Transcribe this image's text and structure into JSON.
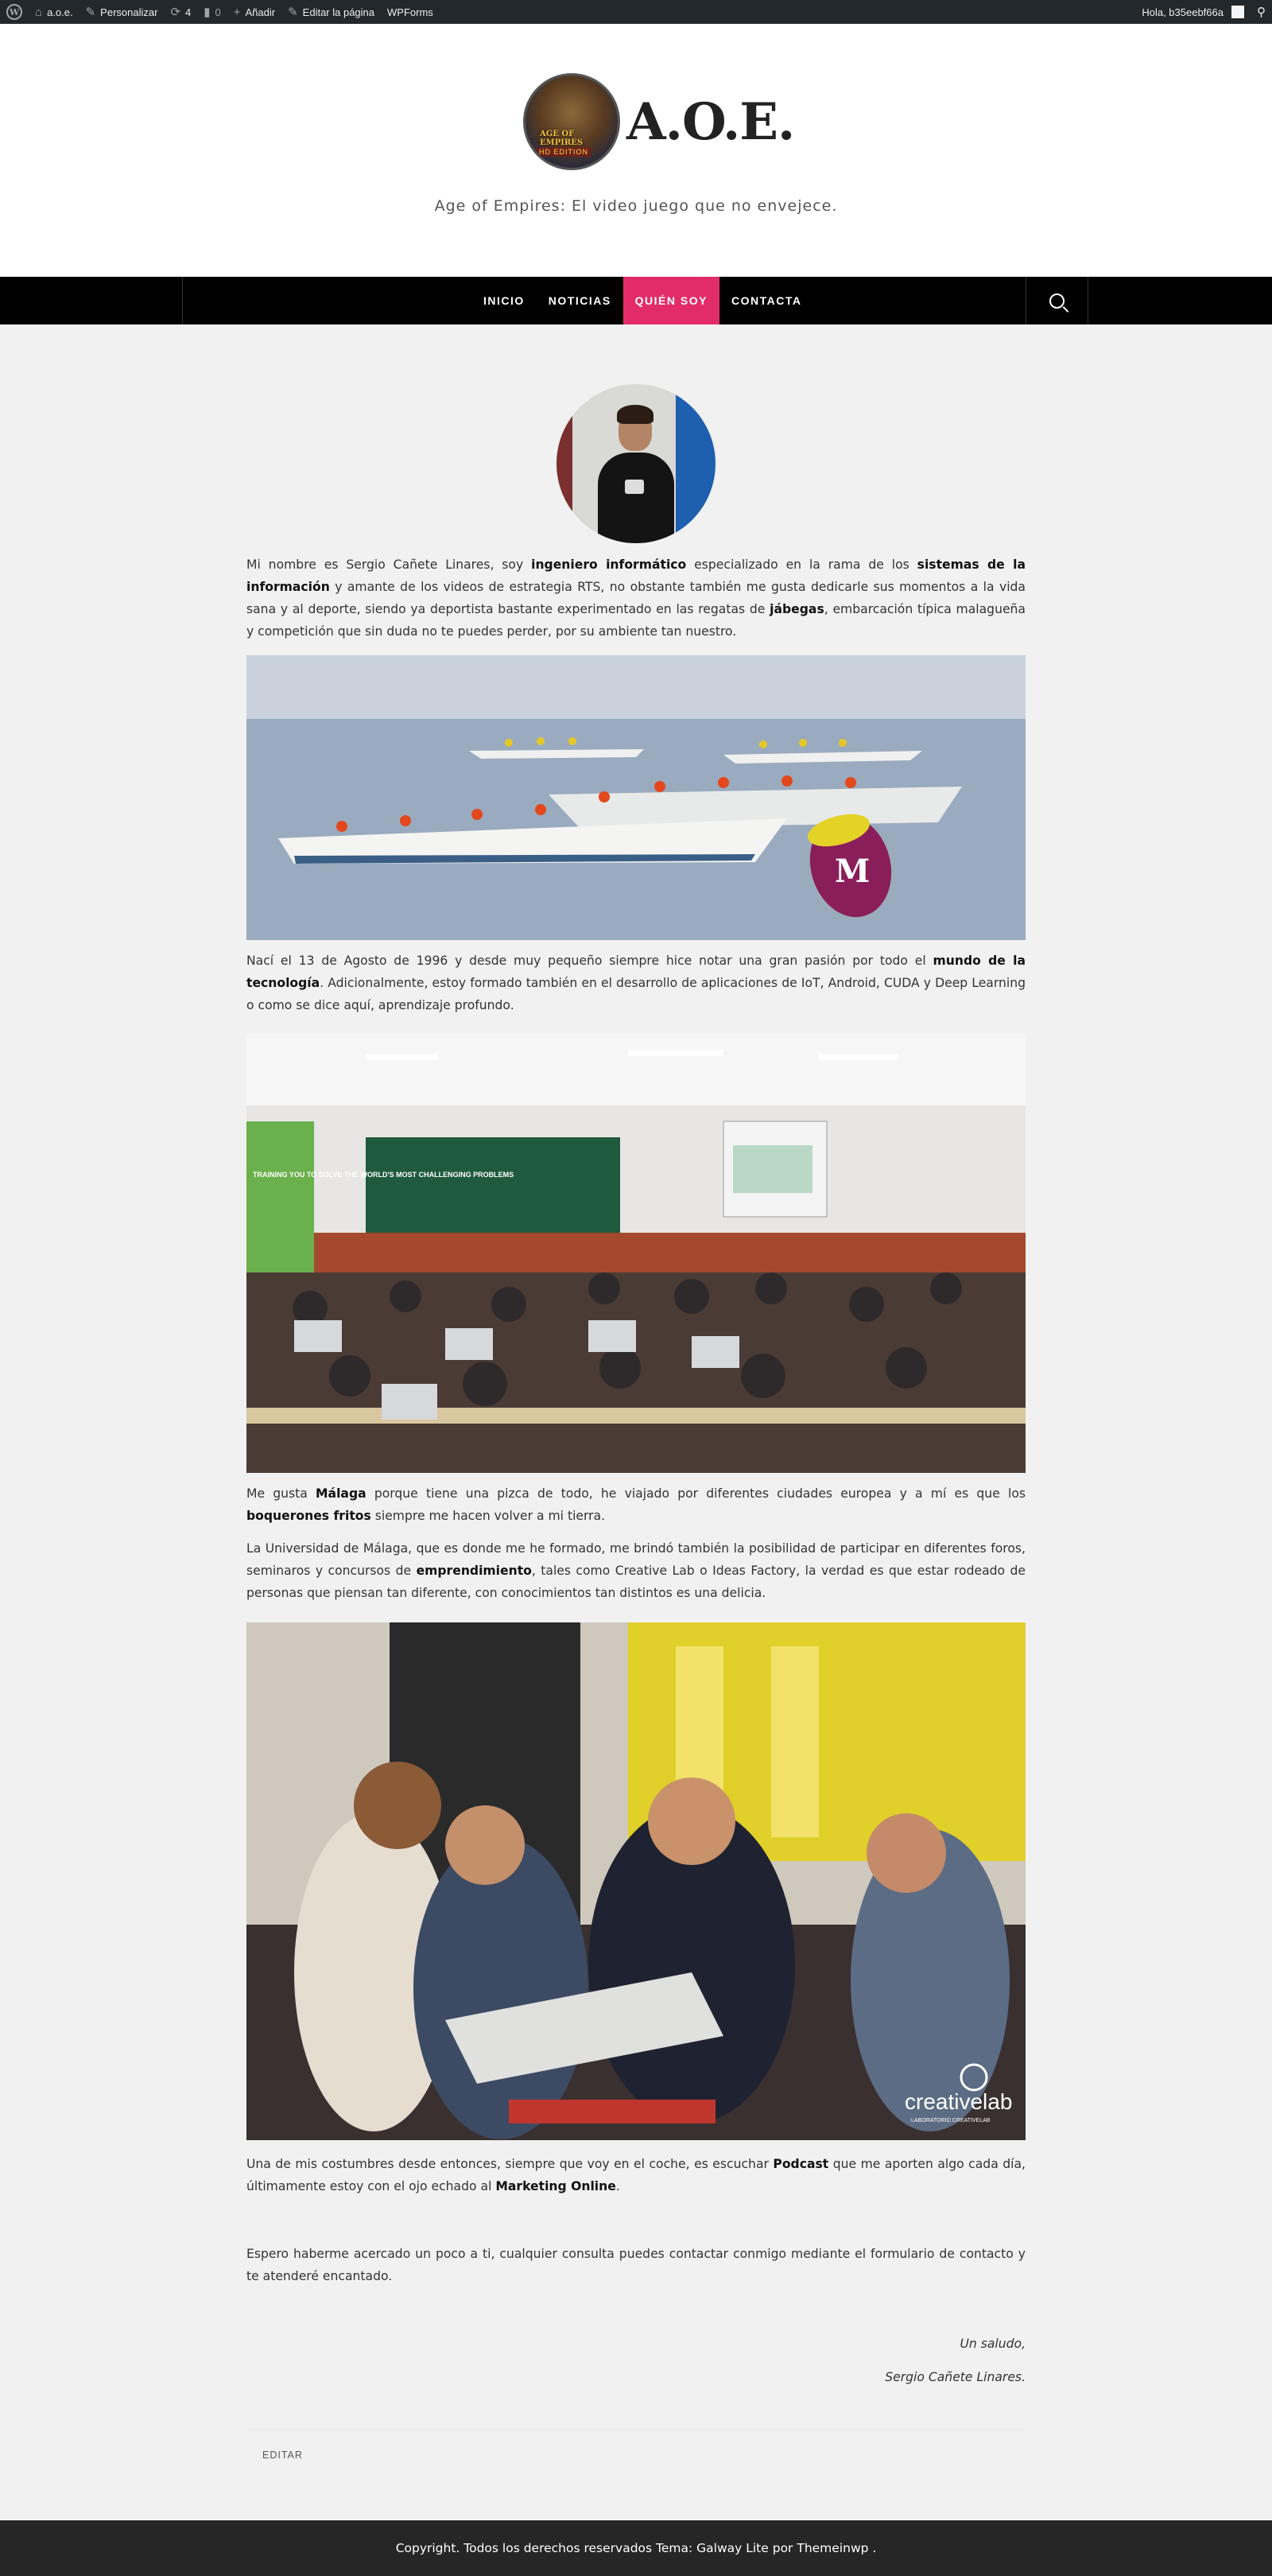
{
  "adminbar": {
    "site": "a.o.e.",
    "customize": "Personalizar",
    "updates_count": "4",
    "comments_count": "0",
    "add_new": "Añadir",
    "edit_page": "Editar la página",
    "wpforms": "WPForms",
    "greeting": "Hola, b35eebf66a",
    "icons": [
      "wordpress-logo-icon",
      "home-icon",
      "brush-icon",
      "refresh-icon",
      "comment-icon",
      "plus-icon",
      "pencil-icon",
      "search-icon"
    ]
  },
  "header": {
    "logo_text_1": "AGE OF EMPIRES",
    "logo_text_2": "HD EDITION",
    "title": "A.O.E.",
    "tagline": "Age of Empires: El video juego que no envejece."
  },
  "nav": {
    "items": [
      {
        "label": "INICIO"
      },
      {
        "label": "NOTICIAS"
      },
      {
        "label": "QUIÉN SOY"
      },
      {
        "label": "CONTACTA"
      }
    ],
    "active_color": "#e22c6a"
  },
  "content": {
    "p1": {
      "a": "Mi nombre es Sergio Cañete Linares, soy ",
      "b1": "ingeniero informático",
      "c": " especializado en la rama de los ",
      "b2": "sistemas de la información",
      "d": " y amante de los videos de estrategia RTS, no obstante también me gusta dedicarle sus momentos a la vida sana y al deporte, siendo ya deportista bastante experimentado en las regatas de ",
      "b3": "jábegas",
      "e": ", embarcación típica malagueña y competición que sin duda no te puedes perder, por su ambiente tan nuestro."
    },
    "p2": {
      "a": "Nací el 13 de Agosto de 1996 y desde muy pequeño siempre hice notar una gran pasión por todo el ",
      "b1": "mundo de la tecnología",
      "c": ". Adicionalmente, estoy formado también en el desarrollo de aplicaciones de IoT, Android, CUDA y Deep Learning o como se dice aquí, aprendizaje profundo."
    },
    "p3": {
      "a": "Me gusta ",
      "b1": "Málaga",
      "c": " porque tiene una pizca de todo, he viajado por diferentes ciudades europea y a mí es que los ",
      "b2": "boquerones fritos",
      "d": " siempre me hacen volver a mi tierra."
    },
    "p4": {
      "a": "La Universidad de Málaga, que es donde me he formado, me brindó también la posibilidad de participar en diferentes foros, seminaros y concursos de ",
      "b1": "emprendimiento",
      "c": ", tales como Creative Lab o Ideas Factory, la verdad es que estar rodeado de personas que piensan tan diferente, con conocimientos tan distintos es una delicia."
    },
    "p5": {
      "a": "Una de mis costumbres desde entonces, siempre que voy en el coche, es escuchar ",
      "b1": "Podcast",
      "c": " que me aporten algo cada día, últimamente estoy con el ojo echado al ",
      "b2": "Marketing Online",
      "d": "."
    },
    "p6": "Espero haberme acercado un poco a ti, cualquier consulta puedes contactar conmigo mediante el formulario de contacto y te atenderé encantado.",
    "sign1": "Un saludo,",
    "sign2": "Sergio Cañete Linares.",
    "edit": "EDITAR",
    "img2_banner": "TRAINING YOU TO SOLVE THE WORLD'S MOST CHALLENGING PROBLEMS",
    "img3_brand": "creativelab",
    "img3_sub": "LABORATORIO CREATIVELAB"
  },
  "footer": {
    "text": "Copyright. Todos los derechos reservados Tema: Galway Lite por Themeinwp ."
  }
}
